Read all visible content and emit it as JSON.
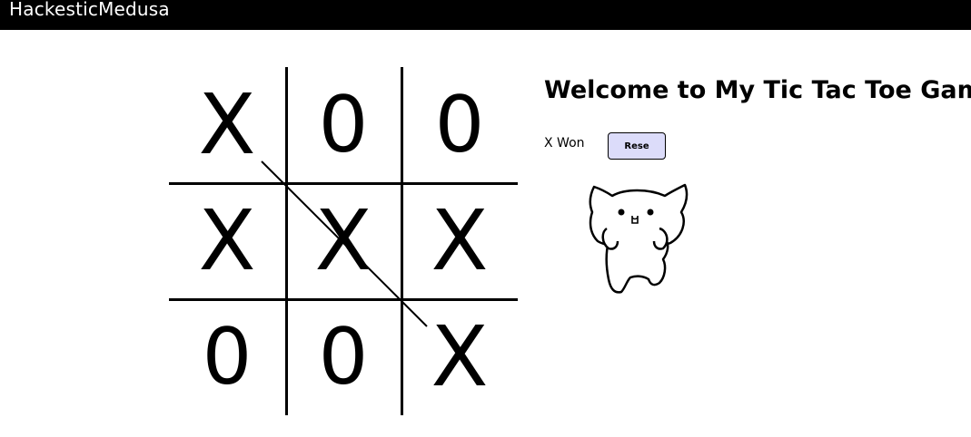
{
  "header": {
    "brand": "HackesticMedusa"
  },
  "game": {
    "title": "Welcome to My Tic Tac Toe Game",
    "status": "X Won",
    "reset_label": "Rese",
    "cells": [
      "X",
      "0",
      "0",
      "X",
      "X",
      "X",
      "0",
      "0",
      "X"
    ],
    "winning_line": "diagonal top-left to bottom-right",
    "mascot": "cat-sticker-icon"
  }
}
